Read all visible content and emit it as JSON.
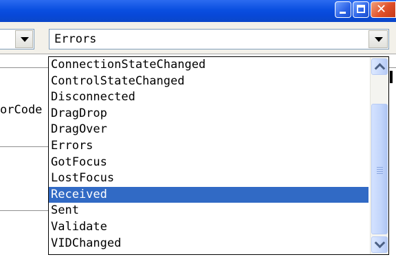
{
  "window": {
    "controls": {
      "minimize_icon": "minimize-icon",
      "maximize_icon": "maximize-icon",
      "close_icon": "close-icon",
      "close_glyph": "✕"
    },
    "title_bar_color": "#0a4fe0"
  },
  "object_combo": {
    "dropdown_icon": "chevron-down-icon"
  },
  "procedure_combo": {
    "value": "Errors",
    "dropdown_icon": "chevron-down-icon",
    "list": {
      "items": [
        "ConnectionStateChanged",
        "ControlStateChanged",
        "Disconnected",
        "DragDrop",
        "DragOver",
        "Errors",
        "GotFocus",
        "LostFocus",
        "Received",
        "Sent",
        "Validate",
        "VIDChanged"
      ],
      "selected": "Received",
      "selected_color": "#316ac5"
    }
  },
  "code_window": {
    "partial_text": "orCode"
  }
}
